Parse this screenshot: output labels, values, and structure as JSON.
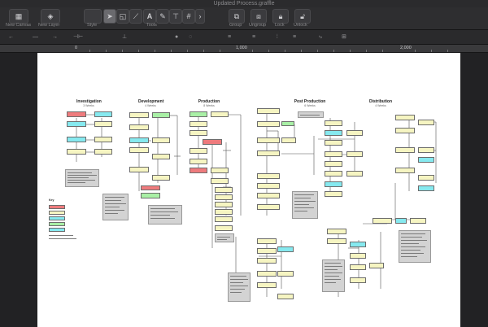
{
  "window": {
    "title": "Updated Process.graffle"
  },
  "toolbar": {
    "new_canvas_label": "New Canvas",
    "new_layer_label": "New Layer",
    "style_label": "Style",
    "tools_label": "Tools",
    "group_label": "Group",
    "ungroup_label": "Ungroup",
    "lock_label": "Lock",
    "unlock_label": "Unlock"
  },
  "ruler": {
    "marks": [
      "0",
      "1,000",
      "2,000"
    ]
  },
  "diagram": {
    "lanes": [
      {
        "title": "Investigation",
        "sub": "3 Weeks"
      },
      {
        "title": "Development",
        "sub": "4 Weeks"
      },
      {
        "title": "Production",
        "sub": "8 Weeks"
      },
      {
        "title": "Post Production",
        "sub": "6 Weeks"
      },
      {
        "title": "Distribution",
        "sub": "4 Weeks"
      }
    ],
    "legend_title": "Key"
  },
  "colors": {
    "yellow": "#f6f5c2",
    "cyan": "#86e9ef",
    "green": "#a9f0a6",
    "red": "#ee7b7d"
  }
}
